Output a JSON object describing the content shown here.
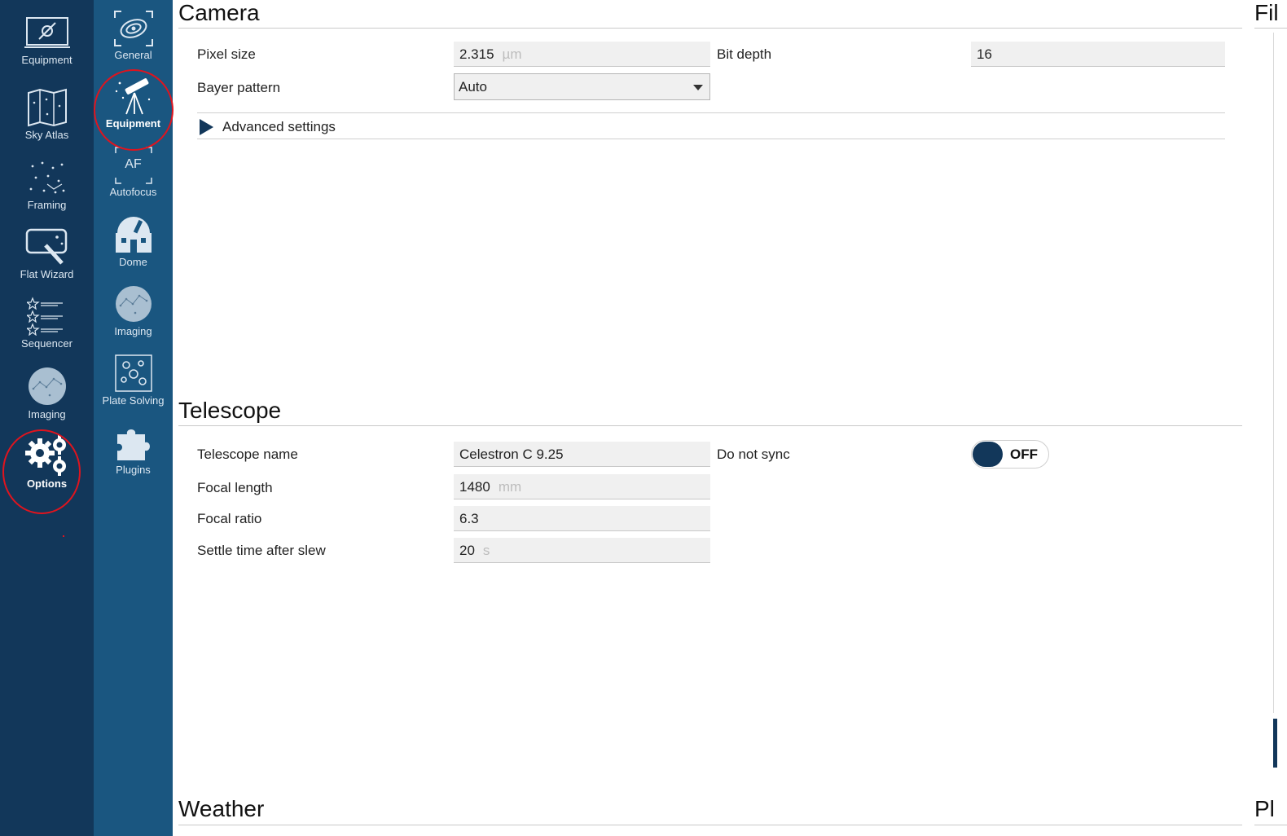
{
  "nav_primary": {
    "items": [
      {
        "label": "Equipment",
        "icon": "equipment-icon"
      },
      {
        "label": "Sky Atlas",
        "icon": "sky-atlas-icon"
      },
      {
        "label": "Framing",
        "icon": "framing-icon"
      },
      {
        "label": "Flat Wizard",
        "icon": "flat-wizard-icon"
      },
      {
        "label": "Sequencer",
        "icon": "sequencer-icon"
      },
      {
        "label": "Imaging",
        "icon": "imaging-icon"
      },
      {
        "label": "Options",
        "icon": "gears-icon",
        "active": true
      }
    ]
  },
  "nav_secondary": {
    "items": [
      {
        "label": "General",
        "icon": "general-icon"
      },
      {
        "label": "Equipment",
        "icon": "telescope-icon",
        "active": true
      },
      {
        "label": "Autofocus",
        "icon": "autofocus-icon",
        "icon_text": "AF"
      },
      {
        "label": "Dome",
        "icon": "dome-icon"
      },
      {
        "label": "Imaging",
        "icon": "imaging-icon"
      },
      {
        "label": "Plate Solving",
        "icon": "plate-solving-icon"
      },
      {
        "label": "Plugins",
        "icon": "puzzle-icon"
      }
    ]
  },
  "camera": {
    "title": "Camera",
    "pixel_size": {
      "label": "Pixel size",
      "value": "2.315",
      "unit": "µm"
    },
    "bit_depth": {
      "label": "Bit depth",
      "value": "16"
    },
    "bayer_pattern": {
      "label": "Bayer pattern",
      "value": "Auto"
    },
    "advanced_label": "Advanced settings"
  },
  "telescope": {
    "title": "Telescope",
    "name": {
      "label": "Telescope name",
      "value": "Celestron C 9.25"
    },
    "do_not_sync": {
      "label": "Do not sync",
      "state": "OFF"
    },
    "focal_length": {
      "label": "Focal length",
      "value": "1480",
      "unit": "mm"
    },
    "focal_ratio": {
      "label": "Focal ratio",
      "value": "6.3"
    },
    "settle_time": {
      "label": "Settle time after slew",
      "value": "20",
      "unit": "s"
    }
  },
  "weather": {
    "title": "Weather"
  },
  "right_panel": {
    "top_title": "Fil",
    "bottom_title": "Pl"
  },
  "colors": {
    "nav_primary_bg": "#12375a",
    "nav_secondary_bg": "#1a5680",
    "accent": "#12375a",
    "annotation": "#e0141e"
  }
}
